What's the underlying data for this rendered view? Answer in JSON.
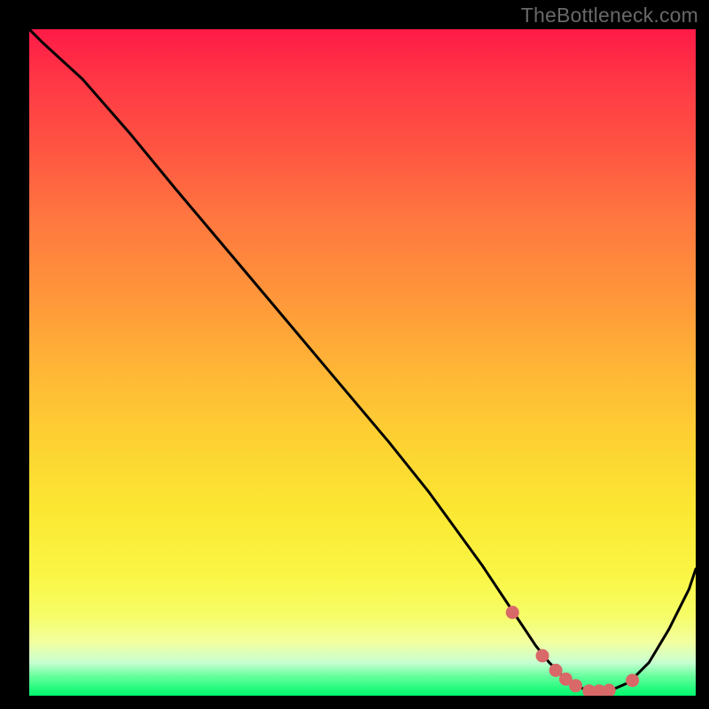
{
  "watermark": "TheBottleneck.com",
  "chart_data": {
    "type": "line",
    "title": "",
    "xlabel": "",
    "ylabel": "",
    "xlim": [
      0,
      100
    ],
    "ylim": [
      0,
      100
    ],
    "series": [
      {
        "name": "curve",
        "x": [
          0,
          2,
          8,
          15,
          22,
          30,
          38,
          46,
          54,
          60,
          64,
          68,
          72,
          74,
          76,
          78,
          80,
          82,
          84,
          87,
          90,
          93,
          96,
          99,
          100
        ],
        "y": [
          100,
          98,
          92.5,
          84.5,
          76,
          66.5,
          57,
          47.5,
          38,
          30.5,
          25,
          19.5,
          13.5,
          10.5,
          7.5,
          5,
          3,
          1.5,
          0.7,
          0.7,
          2,
          5,
          10,
          16,
          19
        ]
      }
    ],
    "markers": {
      "name": "highlight-dots",
      "color": "#d96868",
      "points": [
        {
          "x": 72.5,
          "y": 12.5
        },
        {
          "x": 77,
          "y": 6
        },
        {
          "x": 79,
          "y": 3.8
        },
        {
          "x": 80.5,
          "y": 2.5
        },
        {
          "x": 82,
          "y": 1.5
        },
        {
          "x": 84,
          "y": 0.7
        },
        {
          "x": 85.5,
          "y": 0.7
        },
        {
          "x": 87,
          "y": 0.8
        },
        {
          "x": 90.5,
          "y": 2.3
        }
      ]
    }
  }
}
